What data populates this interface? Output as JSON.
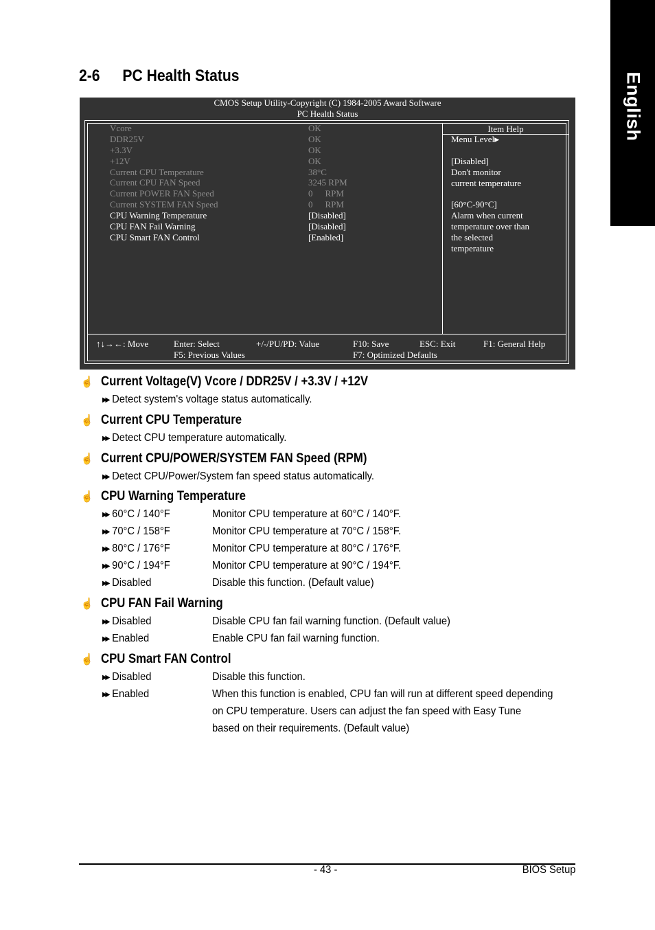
{
  "side_tab": {
    "label": "English"
  },
  "section": {
    "number": "2-6",
    "title": "PC Health Status"
  },
  "bios": {
    "header_line1": "CMOS Setup Utility-Copyright (C) 1984-2005 Award Software",
    "header_line2": "PC Health Status",
    "items": [
      {
        "label": "Vcore",
        "value": "OK",
        "state": "readonly"
      },
      {
        "label": "DDR25V",
        "value": "OK",
        "state": "readonly"
      },
      {
        "label": "+3.3V",
        "value": "OK",
        "state": "readonly"
      },
      {
        "label": "+12V",
        "value": "OK",
        "state": "readonly"
      },
      {
        "label": "Current CPU Temperature",
        "value": "38°C",
        "state": "readonly"
      },
      {
        "label": "Current CPU FAN Speed",
        "value": "3245 RPM",
        "state": "readonly"
      },
      {
        "label": "Current POWER FAN Speed",
        "value": "0",
        "unit": "RPM",
        "state": "readonly"
      },
      {
        "label": "Current SYSTEM FAN Speed",
        "value": "0",
        "unit": "RPM",
        "state": "readonly"
      },
      {
        "label": "CPU Warning Temperature",
        "value": "[Disabled]",
        "state": "editable"
      },
      {
        "label": "CPU FAN Fail Warning",
        "value": "[Disabled]",
        "state": "editable"
      },
      {
        "label": "CPU Smart FAN Control",
        "value": "[Enabled]",
        "state": "editable"
      }
    ],
    "item_help": {
      "title": "Item Help",
      "menu_level": "Menu Level",
      "lines": [
        "",
        "[Disabled]",
        "Don't monitor",
        "current temperature",
        "",
        "[60°C-90°C]",
        "Alarm when current",
        "temperature over than",
        "the selected",
        "temperature"
      ]
    },
    "keys": {
      "move": "↑↓→←: Move",
      "enter": "Enter: Select",
      "value": "+/-/PU/PD: Value",
      "save": "F10: Save",
      "exit": "ESC: Exit",
      "help": "F1: General Help",
      "previous": "F5: Previous Values",
      "defaults": "F7: Optimized Defaults"
    }
  },
  "sections": [
    {
      "heading": "Current Voltage(V) Vcore / DDR25V / +3.3V / +12V",
      "description": "Detect system's voltage status automatically."
    },
    {
      "heading": "Current CPU Temperature",
      "description": "Detect CPU temperature automatically."
    },
    {
      "heading": "Current CPU/POWER/SYSTEM FAN Speed (RPM)",
      "description": "Detect CPU/Power/System fan speed status automatically."
    },
    {
      "heading": "CPU Warning Temperature",
      "options": [
        {
          "key": "60°C / 140°F",
          "value": "Monitor CPU temperature at 60°C / 140°F."
        },
        {
          "key": "70°C / 158°F",
          "value": "Monitor CPU temperature at 70°C / 158°F."
        },
        {
          "key": "80°C / 176°F",
          "value": "Monitor CPU temperature at 80°C / 176°F."
        },
        {
          "key": "90°C / 194°F",
          "value": "Monitor CPU temperature at 90°C / 194°F."
        },
        {
          "key": "Disabled",
          "value": "Disable this function. (Default value)"
        }
      ]
    },
    {
      "heading": "CPU FAN Fail Warning",
      "options": [
        {
          "key": "Disabled",
          "value": "Disable CPU fan fail warning function. (Default value)"
        },
        {
          "key": "Enabled",
          "value": "Enable CPU fan fail warning function."
        }
      ]
    },
    {
      "heading": "CPU Smart FAN Control",
      "options": [
        {
          "key": "Disabled",
          "value": "Disable this function."
        },
        {
          "key": "Enabled",
          "value": "When this function is enabled, CPU fan will run at different speed depending",
          "continuation": [
            "on CPU temperature. Users can adjust the fan speed with Easy Tune",
            "based on their requirements.  (Default value)"
          ]
        }
      ]
    }
  ],
  "footer": {
    "page": "- 43 -",
    "right": "BIOS Setup"
  }
}
